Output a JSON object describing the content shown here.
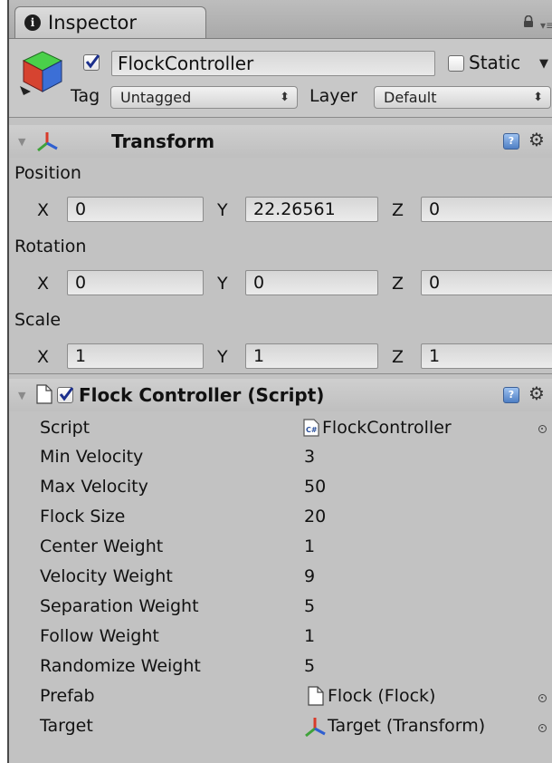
{
  "tab": {
    "title": "Inspector",
    "info_icon": "info-icon"
  },
  "header": {
    "active": true,
    "object_name": "FlockController",
    "static_label": "Static",
    "static_checked": false,
    "tag_label": "Tag",
    "tag_value": "Untagged",
    "layer_label": "Layer",
    "layer_value": "Default"
  },
  "transform": {
    "title": "Transform",
    "position": {
      "label": "Position",
      "x": "0",
      "y": "22.26561",
      "z": "0"
    },
    "rotation": {
      "label": "Rotation",
      "x": "0",
      "y": "0",
      "z": "0"
    },
    "scale": {
      "label": "Scale",
      "x": "1",
      "y": "1",
      "z": "1"
    },
    "axes": {
      "x": "X",
      "y": "Y",
      "z": "Z"
    }
  },
  "script_component": {
    "title_main": "Flock Controller",
    "title_suffix": "(Script)",
    "enabled": true,
    "properties": [
      {
        "label": "Script",
        "value": "FlockController",
        "kind": "script-ref"
      },
      {
        "label": "Min Velocity",
        "value": "3"
      },
      {
        "label": "Max Velocity",
        "value": "50"
      },
      {
        "label": "Flock Size",
        "value": "20"
      },
      {
        "label": "Center Weight",
        "value": "1"
      },
      {
        "label": "Velocity Weight",
        "value": "9"
      },
      {
        "label": "Separation Weight",
        "value": "5"
      },
      {
        "label": "Follow Weight",
        "value": "1"
      },
      {
        "label": "Randomize Weight",
        "value": "5"
      },
      {
        "label": "Prefab",
        "value": "Flock (Flock)",
        "kind": "prefab-ref"
      },
      {
        "label": "Target",
        "value": "Target (Transform)",
        "kind": "transform-ref"
      }
    ]
  },
  "colors": {
    "panel_bg": "#c2c2c2",
    "help_icon_blue": "#4f7fc4",
    "axis_red": "#d83a2a",
    "axis_green": "#3fa23a",
    "axis_blue": "#2f5fd0"
  }
}
